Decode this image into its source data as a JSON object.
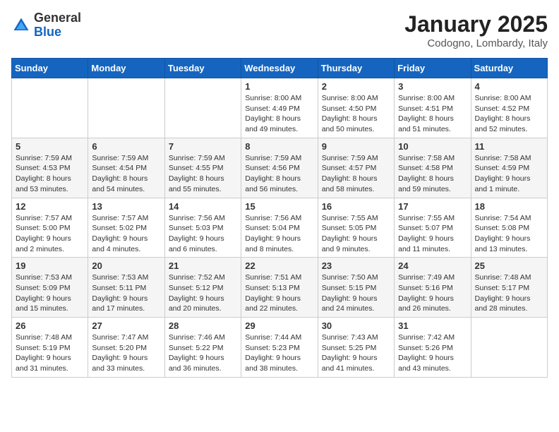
{
  "header": {
    "logo_general": "General",
    "logo_blue": "Blue",
    "month_title": "January 2025",
    "location": "Codogno, Lombardy, Italy"
  },
  "days_of_week": [
    "Sunday",
    "Monday",
    "Tuesday",
    "Wednesday",
    "Thursday",
    "Friday",
    "Saturday"
  ],
  "weeks": [
    [
      {
        "day": "",
        "info": ""
      },
      {
        "day": "",
        "info": ""
      },
      {
        "day": "",
        "info": ""
      },
      {
        "day": "1",
        "info": "Sunrise: 8:00 AM\nSunset: 4:49 PM\nDaylight: 8 hours and 49 minutes."
      },
      {
        "day": "2",
        "info": "Sunrise: 8:00 AM\nSunset: 4:50 PM\nDaylight: 8 hours and 50 minutes."
      },
      {
        "day": "3",
        "info": "Sunrise: 8:00 AM\nSunset: 4:51 PM\nDaylight: 8 hours and 51 minutes."
      },
      {
        "day": "4",
        "info": "Sunrise: 8:00 AM\nSunset: 4:52 PM\nDaylight: 8 hours and 52 minutes."
      }
    ],
    [
      {
        "day": "5",
        "info": "Sunrise: 7:59 AM\nSunset: 4:53 PM\nDaylight: 8 hours and 53 minutes."
      },
      {
        "day": "6",
        "info": "Sunrise: 7:59 AM\nSunset: 4:54 PM\nDaylight: 8 hours and 54 minutes."
      },
      {
        "day": "7",
        "info": "Sunrise: 7:59 AM\nSunset: 4:55 PM\nDaylight: 8 hours and 55 minutes."
      },
      {
        "day": "8",
        "info": "Sunrise: 7:59 AM\nSunset: 4:56 PM\nDaylight: 8 hours and 56 minutes."
      },
      {
        "day": "9",
        "info": "Sunrise: 7:59 AM\nSunset: 4:57 PM\nDaylight: 8 hours and 58 minutes."
      },
      {
        "day": "10",
        "info": "Sunrise: 7:58 AM\nSunset: 4:58 PM\nDaylight: 8 hours and 59 minutes."
      },
      {
        "day": "11",
        "info": "Sunrise: 7:58 AM\nSunset: 4:59 PM\nDaylight: 9 hours and 1 minute."
      }
    ],
    [
      {
        "day": "12",
        "info": "Sunrise: 7:57 AM\nSunset: 5:00 PM\nDaylight: 9 hours and 2 minutes."
      },
      {
        "day": "13",
        "info": "Sunrise: 7:57 AM\nSunset: 5:02 PM\nDaylight: 9 hours and 4 minutes."
      },
      {
        "day": "14",
        "info": "Sunrise: 7:56 AM\nSunset: 5:03 PM\nDaylight: 9 hours and 6 minutes."
      },
      {
        "day": "15",
        "info": "Sunrise: 7:56 AM\nSunset: 5:04 PM\nDaylight: 9 hours and 8 minutes."
      },
      {
        "day": "16",
        "info": "Sunrise: 7:55 AM\nSunset: 5:05 PM\nDaylight: 9 hours and 9 minutes."
      },
      {
        "day": "17",
        "info": "Sunrise: 7:55 AM\nSunset: 5:07 PM\nDaylight: 9 hours and 11 minutes."
      },
      {
        "day": "18",
        "info": "Sunrise: 7:54 AM\nSunset: 5:08 PM\nDaylight: 9 hours and 13 minutes."
      }
    ],
    [
      {
        "day": "19",
        "info": "Sunrise: 7:53 AM\nSunset: 5:09 PM\nDaylight: 9 hours and 15 minutes."
      },
      {
        "day": "20",
        "info": "Sunrise: 7:53 AM\nSunset: 5:11 PM\nDaylight: 9 hours and 17 minutes."
      },
      {
        "day": "21",
        "info": "Sunrise: 7:52 AM\nSunset: 5:12 PM\nDaylight: 9 hours and 20 minutes."
      },
      {
        "day": "22",
        "info": "Sunrise: 7:51 AM\nSunset: 5:13 PM\nDaylight: 9 hours and 22 minutes."
      },
      {
        "day": "23",
        "info": "Sunrise: 7:50 AM\nSunset: 5:15 PM\nDaylight: 9 hours and 24 minutes."
      },
      {
        "day": "24",
        "info": "Sunrise: 7:49 AM\nSunset: 5:16 PM\nDaylight: 9 hours and 26 minutes."
      },
      {
        "day": "25",
        "info": "Sunrise: 7:48 AM\nSunset: 5:17 PM\nDaylight: 9 hours and 28 minutes."
      }
    ],
    [
      {
        "day": "26",
        "info": "Sunrise: 7:48 AM\nSunset: 5:19 PM\nDaylight: 9 hours and 31 minutes."
      },
      {
        "day": "27",
        "info": "Sunrise: 7:47 AM\nSunset: 5:20 PM\nDaylight: 9 hours and 33 minutes."
      },
      {
        "day": "28",
        "info": "Sunrise: 7:46 AM\nSunset: 5:22 PM\nDaylight: 9 hours and 36 minutes."
      },
      {
        "day": "29",
        "info": "Sunrise: 7:44 AM\nSunset: 5:23 PM\nDaylight: 9 hours and 38 minutes."
      },
      {
        "day": "30",
        "info": "Sunrise: 7:43 AM\nSunset: 5:25 PM\nDaylight: 9 hours and 41 minutes."
      },
      {
        "day": "31",
        "info": "Sunrise: 7:42 AM\nSunset: 5:26 PM\nDaylight: 9 hours and 43 minutes."
      },
      {
        "day": "",
        "info": ""
      }
    ]
  ]
}
